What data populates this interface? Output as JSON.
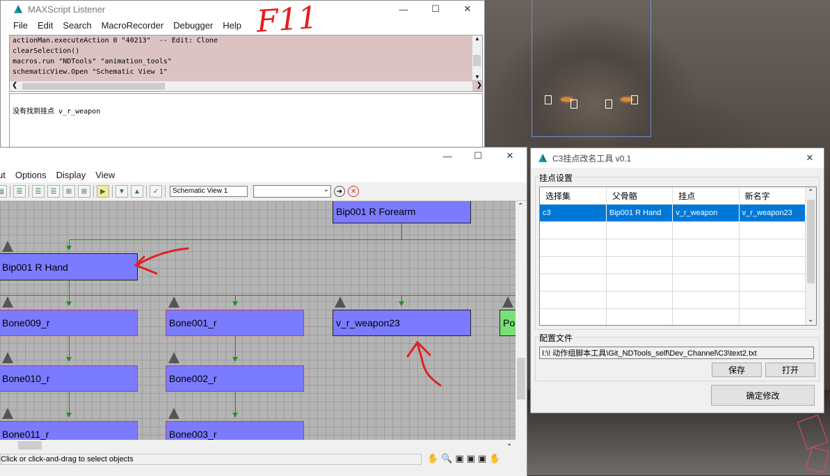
{
  "listener": {
    "title": "MAXScript Listener",
    "menu": [
      "File",
      "Edit",
      "Search",
      "MacroRecorder",
      "Debugger",
      "Help"
    ],
    "macro_lines": [
      "actionMan.executeAction 0 \"40213\"  -- Edit: Clone",
      "clearSelection()",
      "macros.run \"NDTools\" \"animation_tools\"",
      "schematicView.Open \"Schematic View 1\""
    ],
    "output_line": "没有找到挂点 v_r_weapon",
    "annotation": "F11"
  },
  "schematic": {
    "menu": [
      "ut",
      "Options",
      "Display",
      "View"
    ],
    "view_name": "Schematic View 1",
    "nodes": {
      "forearm": "Bip001 R Forearm",
      "hand": "Bip001 R Hand",
      "bone009": "Bone009_r",
      "bone001": "Bone001_r",
      "weapon": "v_r_weapon23",
      "po": "Po",
      "bone010": "Bone010_r",
      "bone002": "Bone002_r",
      "bone011": "Bone011_r",
      "bone003": "Bone003_r"
    },
    "status": "Click or click-and-drag to select objects"
  },
  "c3tool": {
    "title": "C3挂点改名工具 v0.1",
    "group1_label": "挂点设置",
    "columns": [
      "选择集",
      "父骨骼",
      "挂点",
      "新名字"
    ],
    "rows": [
      [
        "c3",
        "Bip001 R Hand",
        "v_r_weapon",
        "v_r_weapon23"
      ]
    ],
    "group2_label": "配置文件",
    "config_path": "I:\\! 动作组脚本工具\\Git_NDTools_self\\Dev_Channel\\C3\\text2.txt",
    "save_label": "保存",
    "open_label": "打开",
    "confirm_label": "确定修改"
  },
  "colors": {
    "node_fill": "#7b7bff",
    "selected_row": "#0078d7",
    "annotation": "#e02020"
  }
}
